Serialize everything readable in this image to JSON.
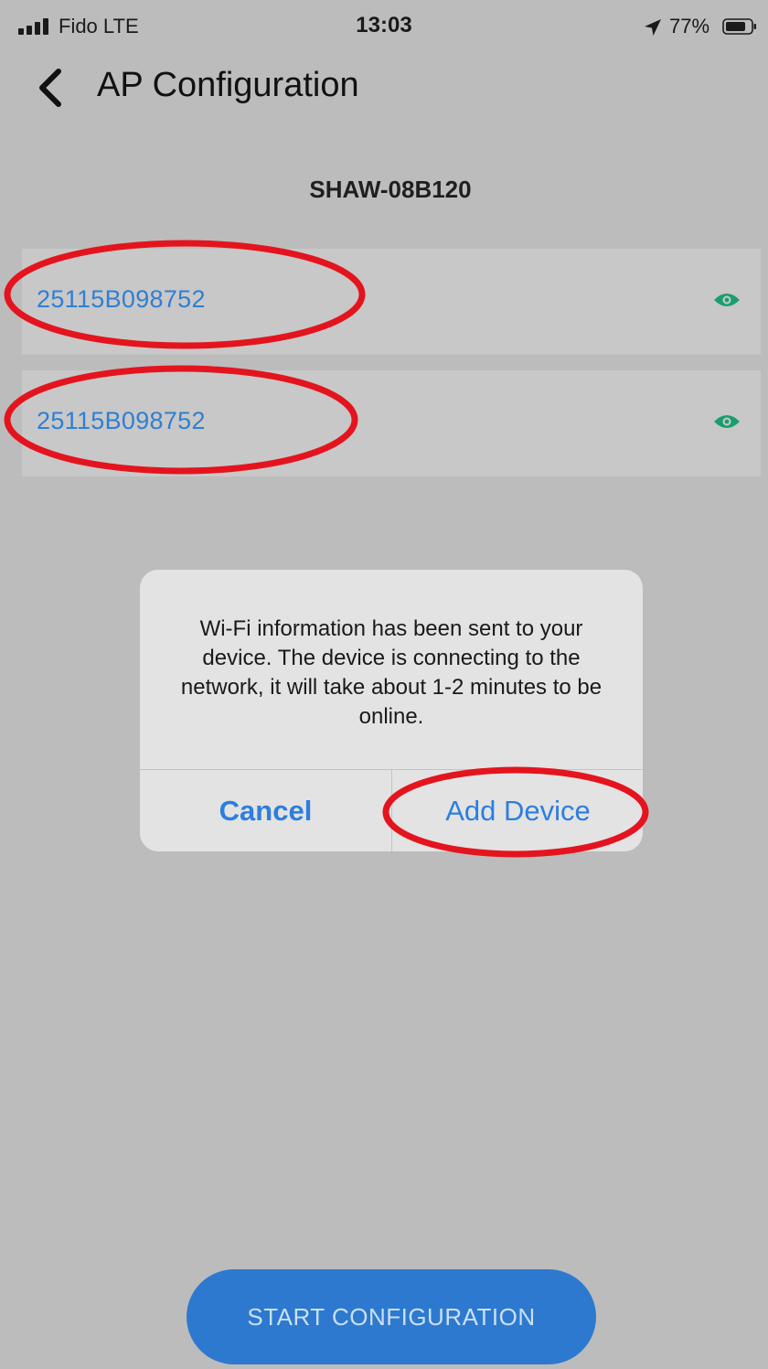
{
  "status_bar": {
    "carrier": "Fido  LTE",
    "time": "13:03",
    "battery": "77%",
    "icons": [
      "signal-icon",
      "location-arrow-icon",
      "battery-icon"
    ]
  },
  "nav": {
    "title": "AP Configuration",
    "back_icon": "chevron-left-icon"
  },
  "ssid": "SHAW-08B120",
  "devices": [
    {
      "id": "25115B098752",
      "icon": "eye-icon"
    },
    {
      "id": "25115B098752",
      "icon": "eye-icon"
    }
  ],
  "dialog": {
    "message": "Wi-Fi information has been sent to your device. The device is connecting to the network, it will take about 1-2 minutes to be online.",
    "cancel_label": "Cancel",
    "add_label": "Add Device"
  },
  "start_button": {
    "label": "START CONFIGURATION"
  },
  "colors": {
    "background": "#bcbcbc",
    "row_background": "#c8c8c8",
    "link_blue": "#2f7fd3",
    "eye_green": "#1a9e6e",
    "dialog_background": "#e3e3e3",
    "button_blue": "#2d79cf",
    "annotation_red": "#e4141e"
  }
}
